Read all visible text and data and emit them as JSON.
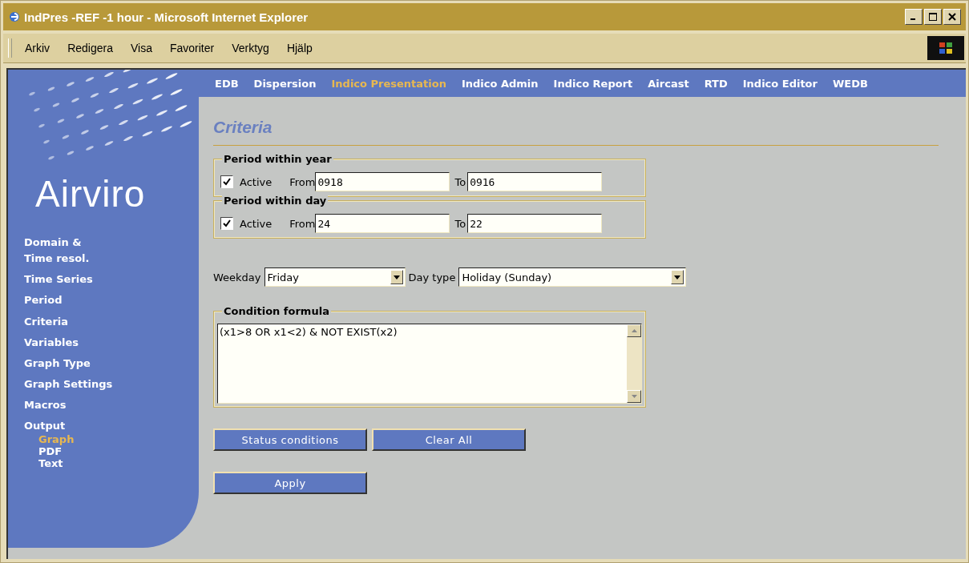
{
  "window": {
    "title": "IndPres -REF -1 hour - Microsoft Internet Explorer"
  },
  "menu": [
    "Arkiv",
    "Redigera",
    "Visa",
    "Favoriter",
    "Verktyg",
    "Hjälp"
  ],
  "nav": [
    {
      "label": "EDB",
      "selected": false
    },
    {
      "label": "Dispersion",
      "selected": false
    },
    {
      "label": "Indico Presentation",
      "selected": true
    },
    {
      "label": "Indico Admin",
      "selected": false
    },
    {
      "label": "Indico Report",
      "selected": false
    },
    {
      "label": "Aircast",
      "selected": false
    },
    {
      "label": "RTD",
      "selected": false
    },
    {
      "label": "Indico Editor",
      "selected": false
    },
    {
      "label": "WEDB",
      "selected": false
    }
  ],
  "logo": "Airviro",
  "sidebar": {
    "items": [
      {
        "label": "Domain &\nTime resol."
      },
      {
        "label": "Time Series"
      },
      {
        "label": "Period"
      },
      {
        "label": "Criteria"
      },
      {
        "label": "Variables"
      },
      {
        "label": "Graph Type"
      },
      {
        "label": "Graph Settings"
      },
      {
        "label": "Macros"
      },
      {
        "label": "Output",
        "children": [
          {
            "label": "Graph",
            "selected": true
          },
          {
            "label": "PDF",
            "selected": false
          },
          {
            "label": "Text",
            "selected": false
          }
        ]
      }
    ]
  },
  "heading": "Criteria",
  "periods": [
    {
      "legend": "Period within year",
      "active_label": "Active",
      "checked": true,
      "from_label": "From",
      "from": "0918",
      "to_label": "To",
      "to": "0916"
    },
    {
      "legend": "Period within day",
      "active_label": "Active",
      "checked": true,
      "from_label": "From",
      "from": "24",
      "to_label": "To",
      "to": "22"
    }
  ],
  "weekday": {
    "label": "Weekday",
    "value": "Friday"
  },
  "day_type": {
    "label": "Day type",
    "value": "Holiday (Sunday)"
  },
  "condition": {
    "legend": "Condition formula",
    "value": "(x1>8 OR x1<2) & NOT EXIST(x2)"
  },
  "buttons": [
    "Status conditions",
    "Clear All"
  ],
  "apply": "Apply"
}
